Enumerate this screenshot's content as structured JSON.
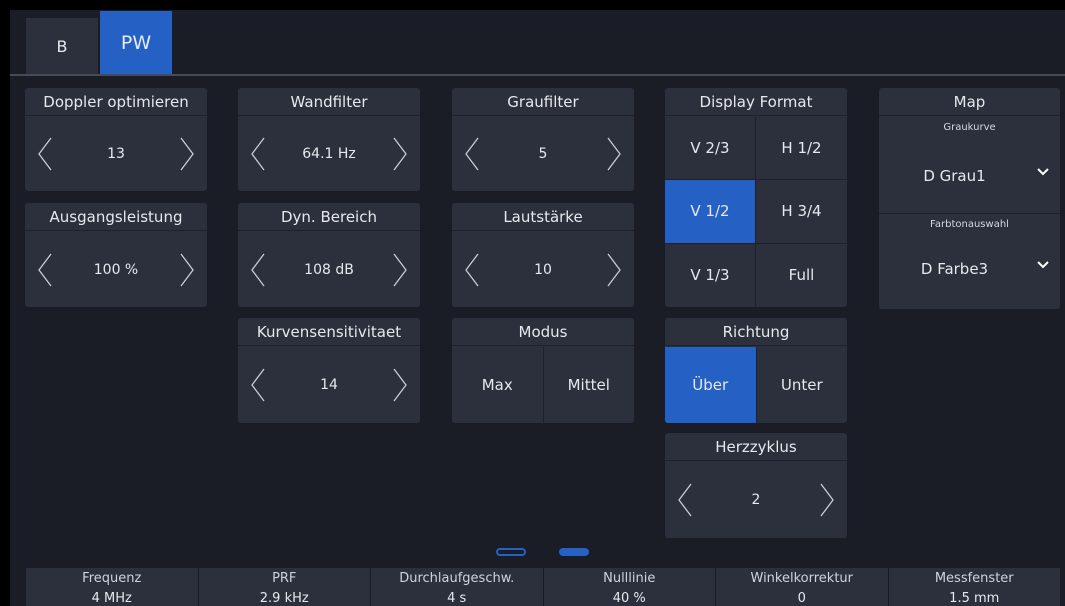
{
  "tabs": [
    {
      "label": "B",
      "active": false
    },
    {
      "label": "PW",
      "active": true
    }
  ],
  "controls": {
    "doppler_optimieren": {
      "label": "Doppler optimieren",
      "value": "13"
    },
    "wandfilter": {
      "label": "Wandfilter",
      "value": "64.1 Hz"
    },
    "graufilter": {
      "label": "Graufilter",
      "value": "5"
    },
    "ausgangsleistung": {
      "label": "Ausgangsleistung",
      "value": "100 %"
    },
    "dyn_bereich": {
      "label": "Dyn. Bereich",
      "value": "108 dB"
    },
    "lautstaerke": {
      "label": "Lautstärke",
      "value": "10"
    },
    "kurvensensitivitaet": {
      "label": "Kurvensensitivitaet",
      "value": "14"
    },
    "herzzyklus": {
      "label": "Herzzyklus",
      "value": "2"
    }
  },
  "display_format": {
    "label": "Display Format",
    "options": [
      "V 2/3",
      "H 1/2",
      "V 1/2",
      "H 3/4",
      "V 1/3",
      "Full"
    ],
    "selected": "V 1/2"
  },
  "map": {
    "label": "Map",
    "graukurve": {
      "label": "Graukurve",
      "value": "D Grau1"
    },
    "farbtonauswahl": {
      "label": "Farbtonauswahl",
      "value": "D Farbe3"
    }
  },
  "modus": {
    "label": "Modus",
    "options": [
      "Max",
      "Mittel"
    ],
    "selected": null
  },
  "richtung": {
    "label": "Richtung",
    "options": [
      "Über",
      "Unter"
    ],
    "selected": "Über"
  },
  "pager": {
    "pages": 2,
    "current": 2
  },
  "status_bar": [
    {
      "label": "Frequenz",
      "value": "4 MHz"
    },
    {
      "label": "PRF",
      "value": "2.9 kHz"
    },
    {
      "label": "Durchlaufgeschw.",
      "value": "4 s"
    },
    {
      "label": "Nulllinie",
      "value": "40 %"
    },
    {
      "label": "Winkelkorrektur",
      "value": "0"
    },
    {
      "label": "Messfenster",
      "value": "1.5 mm"
    }
  ],
  "colors": {
    "background": "#1a1d26",
    "panel": "#2c303c",
    "accent": "#2561c4",
    "text": "#e6e8ee"
  }
}
